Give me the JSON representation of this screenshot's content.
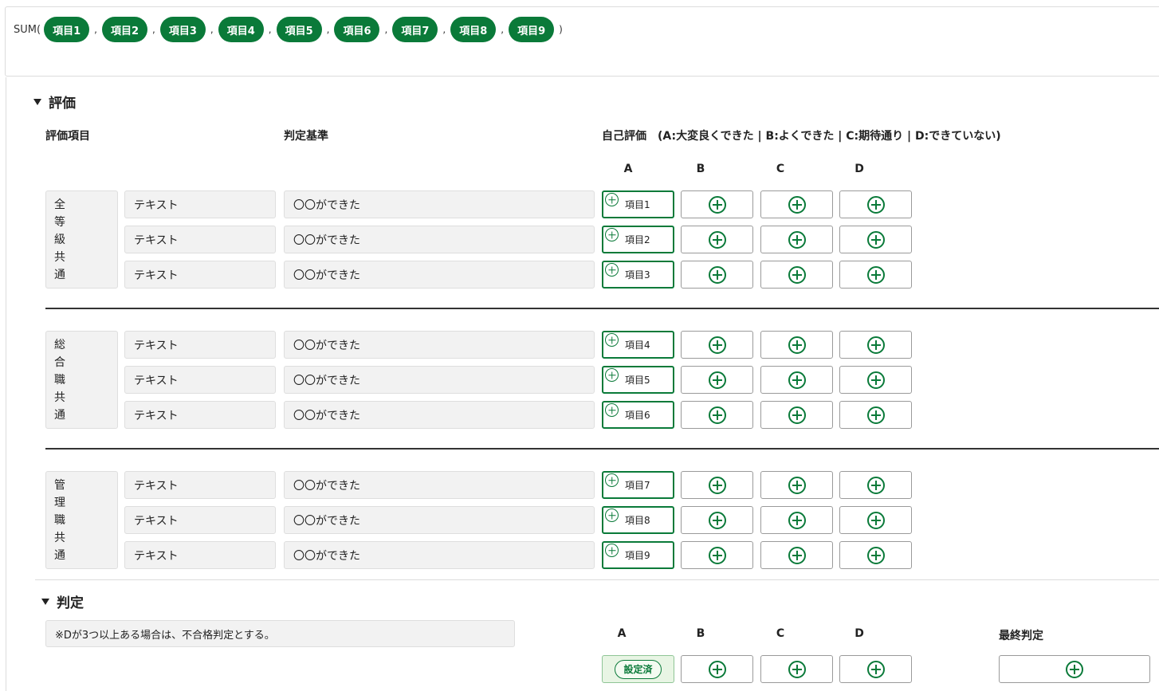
{
  "formula": {
    "prefix": "SUM(",
    "separator": ",",
    "suffix": ")",
    "chips": [
      "項目1",
      "項目2",
      "項目3",
      "項目4",
      "項目5",
      "項目6",
      "項目7",
      "項目8",
      "項目9"
    ]
  },
  "evaluation": {
    "title": "評価",
    "headers": {
      "item": "評価項目",
      "criteria": "判定基準",
      "self": "自己評価　(A:大変良くできた | B:よくできた | C:期待通り | D:できていない)"
    },
    "columns": [
      "A",
      "B",
      "C",
      "D"
    ],
    "groups": [
      {
        "category": [
          "全",
          "等",
          "級",
          "共",
          "通"
        ],
        "rows": [
          {
            "text": "テキスト",
            "criteria": "〇〇ができた",
            "selected": "項目1"
          },
          {
            "text": "テキスト",
            "criteria": "〇〇ができた",
            "selected": "項目2"
          },
          {
            "text": "テキスト",
            "criteria": "〇〇ができた",
            "selected": "項目3"
          }
        ]
      },
      {
        "category": [
          "総",
          "合",
          "職",
          "共",
          "通"
        ],
        "rows": [
          {
            "text": "テキスト",
            "criteria": "〇〇ができた",
            "selected": "項目4"
          },
          {
            "text": "テキスト",
            "criteria": "〇〇ができた",
            "selected": "項目5"
          },
          {
            "text": "テキスト",
            "criteria": "〇〇ができた",
            "selected": "項目6"
          }
        ]
      },
      {
        "category": [
          "管",
          "理",
          "職",
          "共",
          "通"
        ],
        "rows": [
          {
            "text": "テキスト",
            "criteria": "〇〇ができた",
            "selected": "項目7"
          },
          {
            "text": "テキスト",
            "criteria": "〇〇ができた",
            "selected": "項目8"
          },
          {
            "text": "テキスト",
            "criteria": "〇〇ができた",
            "selected": "項目9"
          }
        ]
      }
    ]
  },
  "judgement": {
    "title": "判定",
    "note": "※Dが3つ以上ある場合は、不合格判定とする。",
    "columns": [
      "A",
      "B",
      "C",
      "D"
    ],
    "final_label": "最終判定",
    "set_label": "設定済"
  },
  "colors": {
    "brand_green": "#0a7a39",
    "set_bg": "#e8f5e4"
  },
  "icons": {
    "add": "plus-circle-icon",
    "collapse": "triangle-down-icon"
  }
}
